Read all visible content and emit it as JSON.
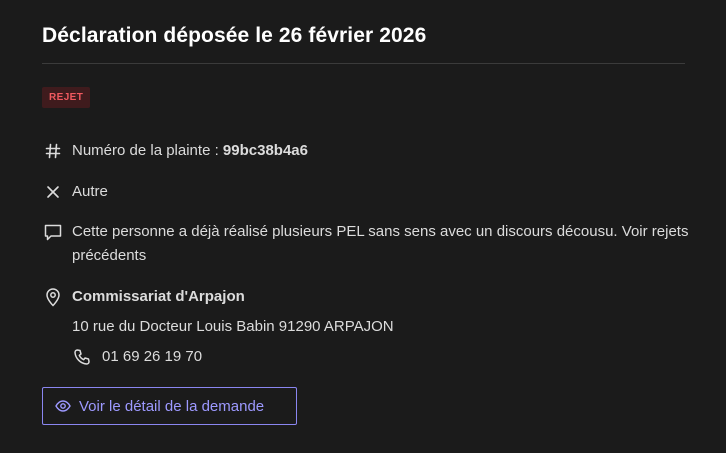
{
  "header": {
    "title": "Déclaration déposée le 26 février 2026"
  },
  "status": {
    "label": "REJET",
    "color": "#f0595f",
    "background": "#3f1b1d"
  },
  "complaint": {
    "label": "Numéro de la plainte : ",
    "number": "99bc38b4a6",
    "icon": "hash-icon"
  },
  "reason": {
    "label": "Autre",
    "icon": "close-icon"
  },
  "comment": {
    "text": "Cette personne a déjà réalisé plusieurs PEL sans sens avec un discours décousu. Voir rejets précédents",
    "icon": "comment-icon"
  },
  "location": {
    "name": "Commissariat d'Arpajon",
    "address": "10 rue du Docteur Louis Babin 91290 ARPAJON",
    "phone": "01 69 26 19 70",
    "icon": "map-pin-icon",
    "phone_icon": "phone-icon"
  },
  "actions": {
    "view_details_label": "Voir le détail de la demande",
    "icon": "eye-icon",
    "accent": "#8a86f0"
  }
}
